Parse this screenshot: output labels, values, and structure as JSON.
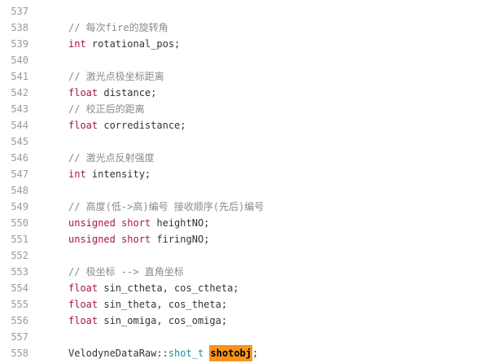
{
  "lines": [
    {
      "n": "537",
      "parts": []
    },
    {
      "n": "538",
      "parts": [
        {
          "t": "// 每次fire的旋转角",
          "c": "comment"
        }
      ]
    },
    {
      "n": "539",
      "parts": [
        {
          "t": "int",
          "c": "kw"
        },
        {
          "t": " rotational_pos;",
          "c": ""
        }
      ]
    },
    {
      "n": "540",
      "parts": []
    },
    {
      "n": "541",
      "parts": [
        {
          "t": "// 激光点极坐标距离",
          "c": "comment"
        }
      ]
    },
    {
      "n": "542",
      "parts": [
        {
          "t": "float",
          "c": "kw"
        },
        {
          "t": " distance;",
          "c": ""
        }
      ]
    },
    {
      "n": "543",
      "parts": [
        {
          "t": "// 校正后的距离",
          "c": "comment"
        }
      ]
    },
    {
      "n": "544",
      "parts": [
        {
          "t": "float",
          "c": "kw"
        },
        {
          "t": " corredistance;",
          "c": ""
        }
      ]
    },
    {
      "n": "545",
      "parts": []
    },
    {
      "n": "546",
      "parts": [
        {
          "t": "// 激光点反射强度",
          "c": "comment"
        }
      ]
    },
    {
      "n": "547",
      "parts": [
        {
          "t": "int",
          "c": "kw"
        },
        {
          "t": " intensity;",
          "c": ""
        }
      ]
    },
    {
      "n": "548",
      "parts": []
    },
    {
      "n": "549",
      "parts": [
        {
          "t": "// 高度(低->高)编号 接收顺序(先后)编号",
          "c": "comment"
        }
      ]
    },
    {
      "n": "550",
      "parts": [
        {
          "t": "unsigned",
          "c": "kw"
        },
        {
          "t": " ",
          "c": ""
        },
        {
          "t": "short",
          "c": "kw"
        },
        {
          "t": " heightNO;",
          "c": ""
        }
      ]
    },
    {
      "n": "551",
      "parts": [
        {
          "t": "unsigned",
          "c": "kw"
        },
        {
          "t": " ",
          "c": ""
        },
        {
          "t": "short",
          "c": "kw"
        },
        {
          "t": " firingNO;",
          "c": ""
        }
      ]
    },
    {
      "n": "552",
      "parts": []
    },
    {
      "n": "553",
      "parts": [
        {
          "t": "// 极坐标 --> 直角坐标",
          "c": "comment"
        }
      ]
    },
    {
      "n": "554",
      "parts": [
        {
          "t": "float",
          "c": "kw"
        },
        {
          "t": " sin_ctheta, cos_ctheta;",
          "c": ""
        }
      ]
    },
    {
      "n": "555",
      "parts": [
        {
          "t": "float",
          "c": "kw"
        },
        {
          "t": " sin_theta, cos_theta;",
          "c": ""
        }
      ]
    },
    {
      "n": "556",
      "parts": [
        {
          "t": "float",
          "c": "kw"
        },
        {
          "t": " sin_omiga, cos_omiga;",
          "c": ""
        }
      ]
    },
    {
      "n": "557",
      "parts": []
    },
    {
      "n": "558",
      "parts": [
        {
          "t": "VelodyneDataRaw::",
          "c": ""
        },
        {
          "t": "shot_t",
          "c": "type"
        },
        {
          "t": " ",
          "c": ""
        },
        {
          "t": "shotobj",
          "c": "hl"
        },
        {
          "t": ";",
          "c": ""
        }
      ]
    }
  ]
}
